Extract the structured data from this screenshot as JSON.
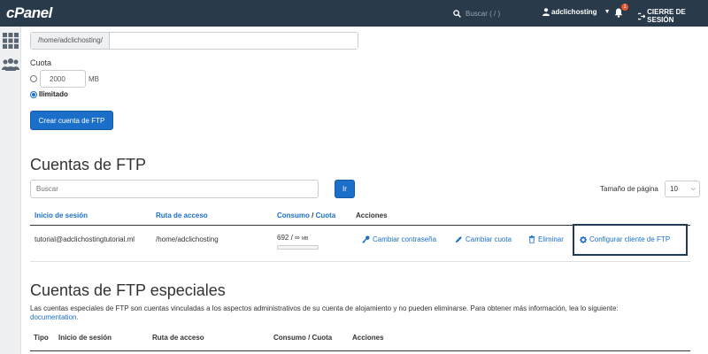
{
  "topbar": {
    "logo": "cPanel",
    "search_placeholder": "Buscar ( / )",
    "username": "adclichosting",
    "notifications_count": "1",
    "logout_label": "CIERRE DE SESIÓN"
  },
  "form": {
    "home_path": "/home/adclichosting/",
    "quota_label": "Cuota",
    "quota_value": "2000",
    "quota_unit": "MB",
    "unlimited_label": "Ilimitado",
    "create_button": "Crear cuenta de FTP"
  },
  "accounts": {
    "title": "Cuentas de FTP",
    "search_placeholder": "Buscar",
    "go_button": "Ir",
    "page_size_label": "Tamaño de página",
    "page_size_value": "10",
    "columns": {
      "login": "Inicio de sesión",
      "path": "Ruta de acceso",
      "usage": "Consumo",
      "usage_sep": " / ",
      "quota": "Cuota",
      "actions": "Acciones"
    },
    "rows": [
      {
        "login": "tutorial@adclichostingtutorial.ml",
        "path": "/home/adclichosting",
        "usage": "692 / ∞",
        "usage_unit": "MB",
        "usage_fraction": 0
      }
    ],
    "actions": {
      "change_password": "Cambiar contraseña",
      "change_quota": "Cambiar cuota",
      "delete": "Eliminar",
      "configure_client": "Configurar cliente de FTP"
    }
  },
  "special": {
    "title": "Cuentas de FTP especiales",
    "description": "Las cuentas especiales de FTP son cuentas vinculadas a los aspectos administrativos de su cuenta de alojamiento y no pueden eliminarse. Para obtener más información, lea lo siguiente:",
    "link": "documentation.",
    "columns": {
      "type": "Tipo",
      "login": "Inicio de sesión",
      "path": "Ruta de acceso",
      "usage_quota": "Consumo / Cuota",
      "actions": "Acciones"
    }
  },
  "colors": {
    "topbar": "#293a4a",
    "accent": "#1b6fc8",
    "highlight_border": "#1f3b56"
  }
}
